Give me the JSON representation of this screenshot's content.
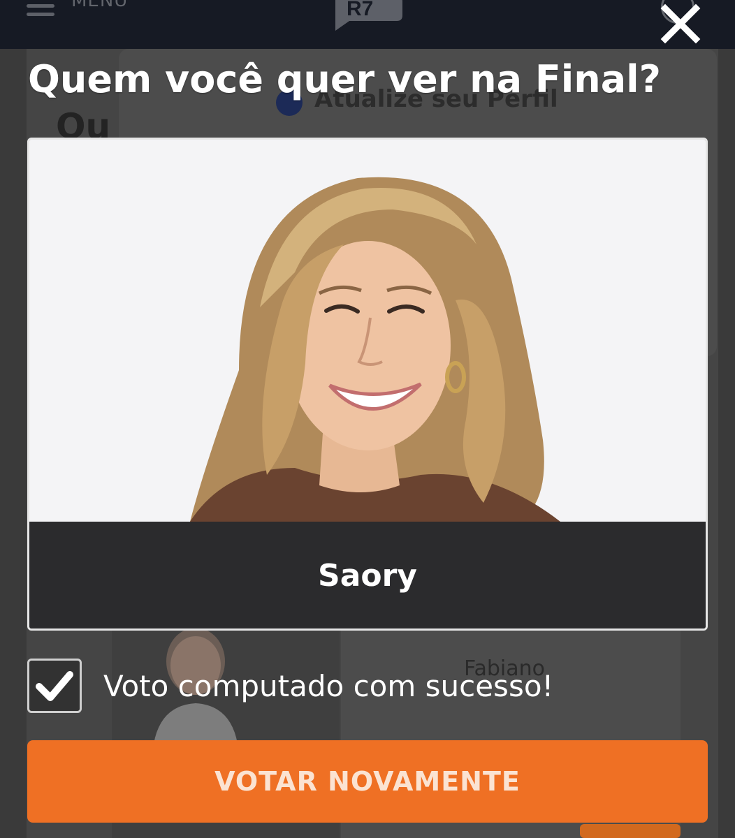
{
  "background": {
    "menu_label": "MENU",
    "card_title": "Atualize seu Perfil",
    "page_title_fragment": "Qu",
    "other_candidate_name": "Fabiano"
  },
  "modal": {
    "title": "Quem você quer ver na Final?",
    "candidate": {
      "name": "Saory"
    },
    "vote_status": {
      "text": "Voto computado com sucesso!",
      "checked": true
    },
    "vote_again_button": "VOTAR NOVAMENTE"
  },
  "colors": {
    "accent": "#ef7024",
    "topbar": "#161a24",
    "card_footer": "#2b2b2d"
  },
  "icons": {
    "close": "close-icon",
    "checkmark": "checkmark-icon",
    "menu": "hamburger-menu-icon",
    "logo": "r7-logo",
    "user": "user-icon"
  }
}
